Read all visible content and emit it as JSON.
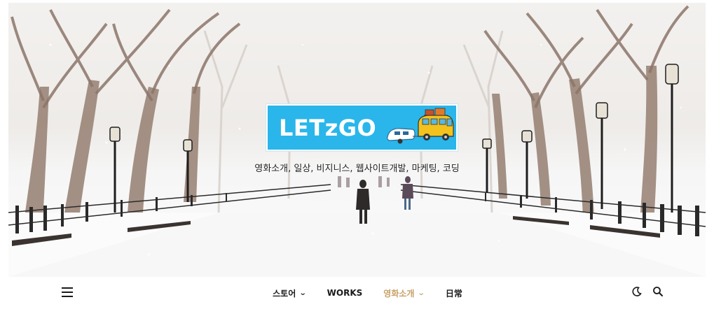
{
  "site": {
    "logo_text": "LETzGO",
    "tagline": "영화소개, 일상, 비지니스, 웹사이트개발, 마케팅, 코딩"
  },
  "nav": {
    "items": [
      {
        "label": "스토어",
        "has_dropdown": true,
        "active": false
      },
      {
        "label": "WORKS",
        "has_dropdown": false,
        "active": false
      },
      {
        "label": "영화소개",
        "has_dropdown": true,
        "active": true
      },
      {
        "label": "日常",
        "has_dropdown": false,
        "active": false
      }
    ],
    "dropdown_glyph": "⌄",
    "icons": [
      "menu-icon",
      "moon-icon",
      "search-icon"
    ]
  },
  "colors": {
    "logo_bg": "#2ab6ea",
    "active_nav": "#c8a064",
    "text": "#1a1a1a"
  }
}
